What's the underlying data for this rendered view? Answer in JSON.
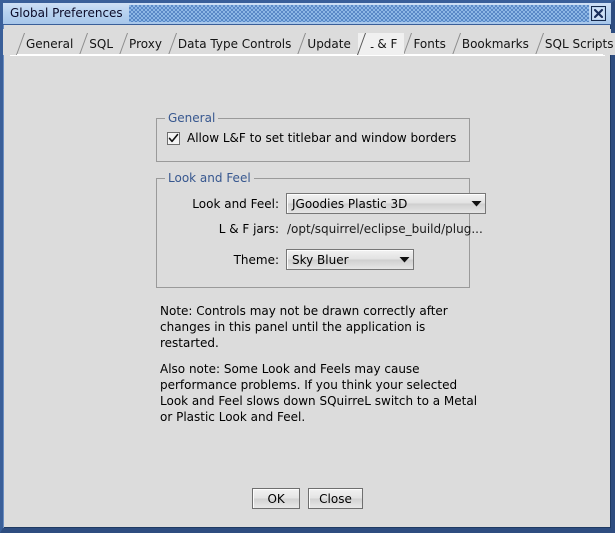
{
  "window": {
    "title": "Global Preferences",
    "close_icon": "close-x-icon"
  },
  "tabs": [
    {
      "label": "General",
      "active": false
    },
    {
      "label": "SQL",
      "active": false
    },
    {
      "label": "Proxy",
      "active": false
    },
    {
      "label": "Data Type Controls",
      "active": false
    },
    {
      "label": "Update",
      "active": false
    },
    {
      "label": "L & F",
      "active": true
    },
    {
      "label": "Fonts",
      "active": false
    },
    {
      "label": "Bookmarks",
      "active": false
    },
    {
      "label": "SQL Scripts",
      "active": false
    }
  ],
  "general_group": {
    "legend": "General",
    "checkbox": {
      "label": "Allow L&F to set titlebar and window borders",
      "checked": true,
      "icon": "checkmark-icon"
    }
  },
  "look_and_feel_group": {
    "legend": "Look and Feel",
    "laf_row": {
      "label": "Look and Feel:",
      "value": "JGoodies Plastic 3D",
      "arrow_icon": "chevron-down-icon"
    },
    "jars_row": {
      "label": "L & F jars:",
      "value": "/opt/squirrel/eclipse_build/plug..."
    },
    "theme_row": {
      "label": "Theme:",
      "value": "Sky Bluer",
      "arrow_icon": "chevron-down-icon"
    }
  },
  "notes": {
    "note_1": "Note: Controls may not be drawn correctly after changes in this panel until the application is restarted.",
    "note_2": "Also note: Some Look and Feels may cause performance problems. If you think your selected Look and Feel slows down SQuirreL switch to a Metal or Plastic Look and Feel."
  },
  "buttons": {
    "ok": "OK",
    "close": "Close"
  },
  "colors": {
    "titlebar_start": "#cfe0f5",
    "titlebar_end": "#a8c7ea",
    "window_border": "#2e4d80",
    "panel_bg": "#dcdcdc",
    "group_legend": "#37578f",
    "active_tab_bg": "#f0f0f0"
  }
}
